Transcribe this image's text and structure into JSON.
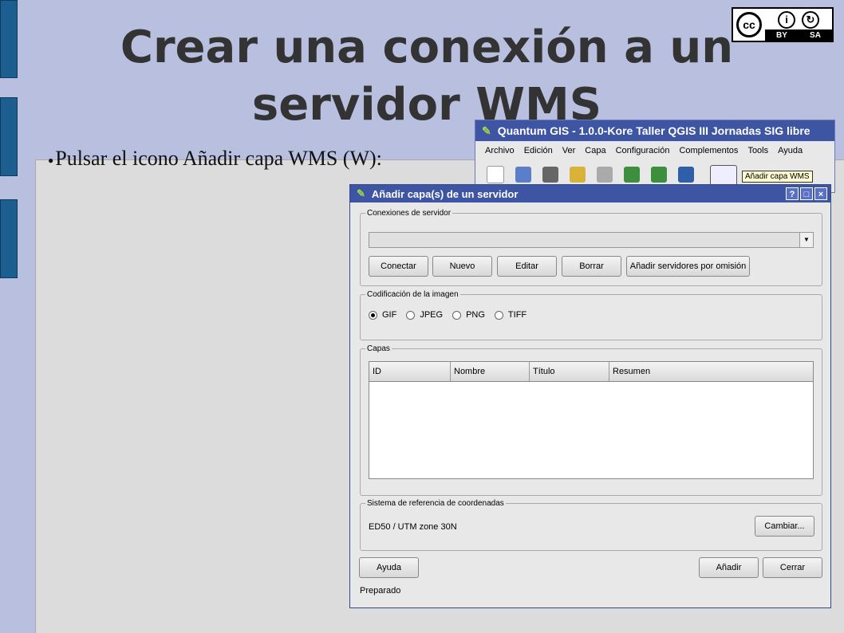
{
  "slide": {
    "title_line1": "Crear una conexión a un",
    "title_line2": "servidor WMS",
    "bullet": "Pulsar el icono Añadir capa WMS (W):"
  },
  "license": {
    "cc": "cc",
    "by": "BY",
    "sa": "SA"
  },
  "qgis": {
    "title": "Quantum GIS - 1.0.0-Kore  Taller QGIS III Jornadas SIG libre",
    "menu": [
      "Archivo",
      "Edición",
      "Ver",
      "Capa",
      "Configuración",
      "Complementos",
      "Tools",
      "Ayuda"
    ],
    "tooltip": "Añadir capa WMS"
  },
  "dialog": {
    "title": "Añadir capa(s) de un servidor",
    "title_buttons": [
      "?",
      "□",
      "×"
    ],
    "connections": {
      "legend": "Conexiones de servidor",
      "combo_value": "",
      "buttons": [
        "Conectar",
        "Nuevo",
        "Editar",
        "Borrar",
        "Añadir servidores por omisión"
      ]
    },
    "encoding": {
      "legend": "Codificación de la imagen",
      "options": [
        "GIF",
        "JPEG",
        "PNG",
        "TIFF"
      ],
      "selected": "GIF"
    },
    "layers": {
      "legend": "Capas",
      "columns": [
        "ID",
        "Nombre",
        "Título",
        "Resumen"
      ]
    },
    "crs": {
      "legend": "Sistema de referencia de coordenadas",
      "value": "ED50 / UTM zone 30N",
      "change_button": "Cambiar..."
    },
    "help_button": "Ayuda",
    "add_button": "Añadir",
    "close_button": "Cerrar",
    "status": "Preparado"
  },
  "colors": {
    "slide_bg": "#b8bfdf",
    "panel_bg": "#dcdcdc",
    "titlebar": "#3e55a3",
    "left_bars": "#1b5e8f"
  }
}
